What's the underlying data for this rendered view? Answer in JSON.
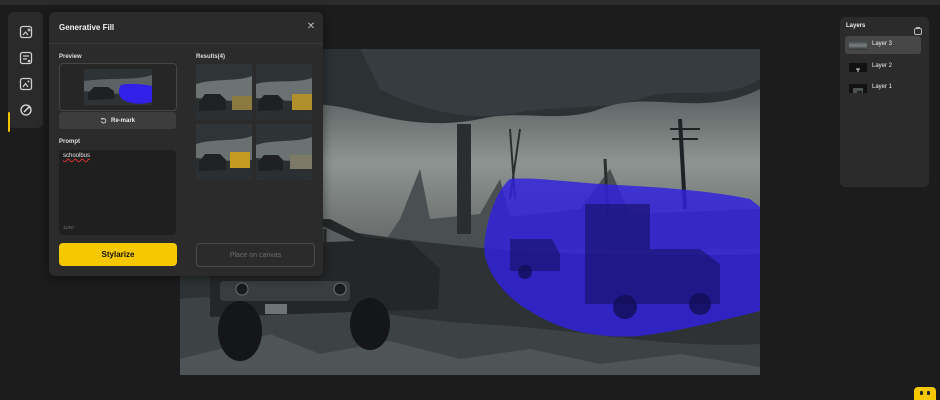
{
  "panel": {
    "title": "Generative Fill",
    "close_icon": "close-icon",
    "preview_label": "Preview",
    "results_label": "Results(4)",
    "remark_label": "Re-mark",
    "prompt_label": "Prompt",
    "prompt_value": "schoolbus",
    "prompt_count": "11/50",
    "stylize_label": "Stylarize",
    "place_label": "Place on canvas"
  },
  "toolbar": {
    "tools": [
      {
        "icon": "image-add-icon",
        "active": false
      },
      {
        "icon": "image-edit-icon",
        "active": false
      },
      {
        "icon": "image-expand-icon",
        "active": false
      },
      {
        "icon": "magic-fill-icon",
        "active": true
      }
    ]
  },
  "layers": {
    "title": "Layers",
    "icon": "layers-icon",
    "items": [
      {
        "label": "Layer 3",
        "active": true
      },
      {
        "label": "Layer 2",
        "active": false
      },
      {
        "label": "Layer 1",
        "active": false
      }
    ]
  },
  "colors": {
    "accent": "#f5c800",
    "mask": "#2f20e0",
    "panel": "#2b2b2b",
    "background": "#1c1c1c"
  }
}
